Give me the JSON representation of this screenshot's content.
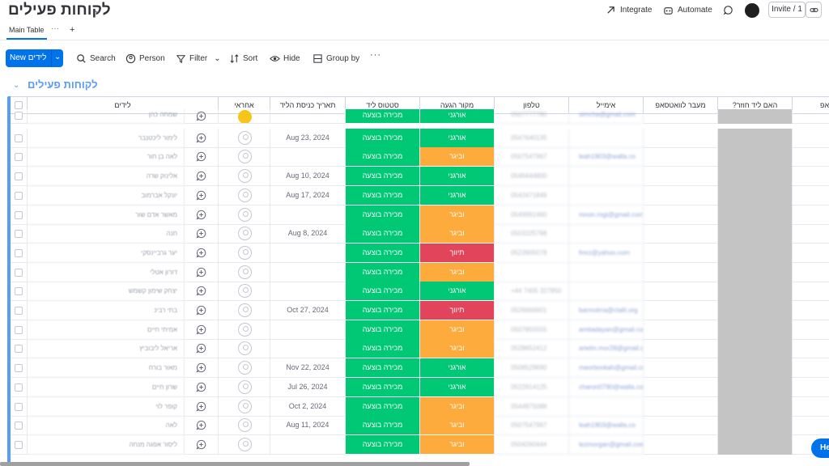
{
  "board": {
    "title": "לקוחות פעילים"
  },
  "top_actions": {
    "integrate": "Integrate",
    "automate": "Automate",
    "invite": "Invite / 1"
  },
  "tabs": {
    "main": "Main Table",
    "more": "···",
    "add": "+"
  },
  "toolbar": {
    "new_label": "New לידים",
    "search": "Search",
    "person": "Person",
    "filter": "Filter",
    "sort": "Sort",
    "hide": "Hide",
    "group_by": "Group by",
    "more": "···"
  },
  "group": {
    "title": "לקוחות פעילים",
    "color": "#579bfc"
  },
  "columns": {
    "leads": "לידים",
    "owner": "אחראי",
    "entry_date": "תאריך כניסת הליד",
    "status": "סטטוס ליד",
    "source": "מקור הגעה",
    "phone": "טלפון",
    "email": "אימייל",
    "whatsapp": "מעבר לוואטסאפ",
    "returning": "?האם ליד חוזר",
    "extra": "אפ"
  },
  "colors": {
    "green": "#00c875",
    "orange": "#fdab3d",
    "red": "#e2445c",
    "accent": "#0073ea"
  },
  "rows": [
    {
      "name": "שמחה כהן",
      "date": "",
      "status": "מכירה בוצעה",
      "source": "אורגני",
      "source_color": "green",
      "phone": "0507777780",
      "email": "simcha@gmail.com"
    },
    {
      "name": "לימור ליכטנבר",
      "date": "Aug 23, 2024",
      "status": "מכירה בוצעה",
      "source": "אורגני",
      "source_color": "green",
      "phone": "0547640135",
      "email": ""
    },
    {
      "name": "לאה בן חור",
      "date": "",
      "status": "מכירה בוצעה",
      "source": "וביגר",
      "source_color": "orange",
      "phone": "0507547967",
      "email": "leah1903@walla.co"
    },
    {
      "name": "אלינוק שרה",
      "date": "Aug 10, 2024",
      "status": "מכירה בוצעה",
      "source": "אורגני",
      "source_color": "green",
      "phone": "0546444800",
      "email": ""
    },
    {
      "name": "יונקל אברמוב",
      "date": "Aug 17, 2024",
      "status": "מכירה בוצעה",
      "source": "אורגני",
      "source_color": "green",
      "phone": "0542471849",
      "email": ""
    },
    {
      "name": "מאשר אדם שור",
      "date": "",
      "status": "מכירה בוצעה",
      "source": "וביגר",
      "source_color": "orange",
      "phone": "0549991460",
      "email": "mnon.rogi@gmail.com"
    },
    {
      "name": "חנה",
      "date": "Aug 8, 2024",
      "status": "מכירה בוצעה",
      "source": "וביגר",
      "source_color": "orange",
      "phone": "0503325788",
      "email": ""
    },
    {
      "name": "יער גרביינסקי",
      "date": "",
      "status": "מכירה בוצעה",
      "source": "תיווך",
      "source_color": "red",
      "phone": "0523905078",
      "email": "fmrz@yahoo.com"
    },
    {
      "name": "דורון אטלי",
      "date": "",
      "status": "מכירה בוצעה",
      "source": "וביגר",
      "source_color": "orange",
      "phone": "",
      "email": ""
    },
    {
      "name": "יצחק שימון קשמש",
      "date": "",
      "status": "מכירה בוצעה",
      "source": "אורגני",
      "source_color": "green",
      "phone": "+44 7405 327850",
      "email": ""
    },
    {
      "name": "בתי רבינ",
      "date": "Oct 27, 2024",
      "status": "מכירה בוצעה",
      "source": "תיווך",
      "source_color": "red",
      "phone": "0526666601",
      "email": "barmotrra@clalit.org"
    },
    {
      "name": "אמיתי חיים",
      "date": "",
      "status": "מכירה בוצעה",
      "source": "וביגר",
      "source_color": "orange",
      "phone": "0507855555",
      "email": "amitadayan@gmail.com"
    },
    {
      "name": "אריאל ליבוביץ",
      "date": "",
      "status": "מכירה בוצעה",
      "source": "וביגר",
      "source_color": "orange",
      "phone": "0528652412",
      "email": "arielm.mor28@gmail.com"
    },
    {
      "name": "מאור בורח",
      "date": "Nov 22, 2024",
      "status": "מכירה בוצעה",
      "source": "אורגני",
      "source_color": "green",
      "phone": "0508529690",
      "email": "maorbovkah@gmail.com"
    },
    {
      "name": "שרון חיים",
      "date": "Jul 26, 2024",
      "status": "מכירה בוצעה",
      "source": "אורגני",
      "source_color": "green",
      "phone": "0522914125",
      "email": "charon0790@walla.com"
    },
    {
      "name": "קופר לוי",
      "date": "Oct 2, 2024",
      "status": "מכירה בוצעה",
      "source": "וביגר",
      "source_color": "orange",
      "phone": "0544975088",
      "email": ""
    },
    {
      "name": "לאה",
      "date": "Aug 11, 2024",
      "status": "מכירה בוצעה",
      "source": "וביגר",
      "source_color": "orange",
      "phone": "0507547967",
      "email": "leah1903@walla.co"
    },
    {
      "name": "ליסור אפגה מנחה",
      "date": "",
      "status": "מכירה בוצעה",
      "source": "וביגר",
      "source_color": "orange",
      "phone": "0504260444",
      "email": "lezmorgan@gmail.com"
    }
  ],
  "help": {
    "label": "He"
  }
}
